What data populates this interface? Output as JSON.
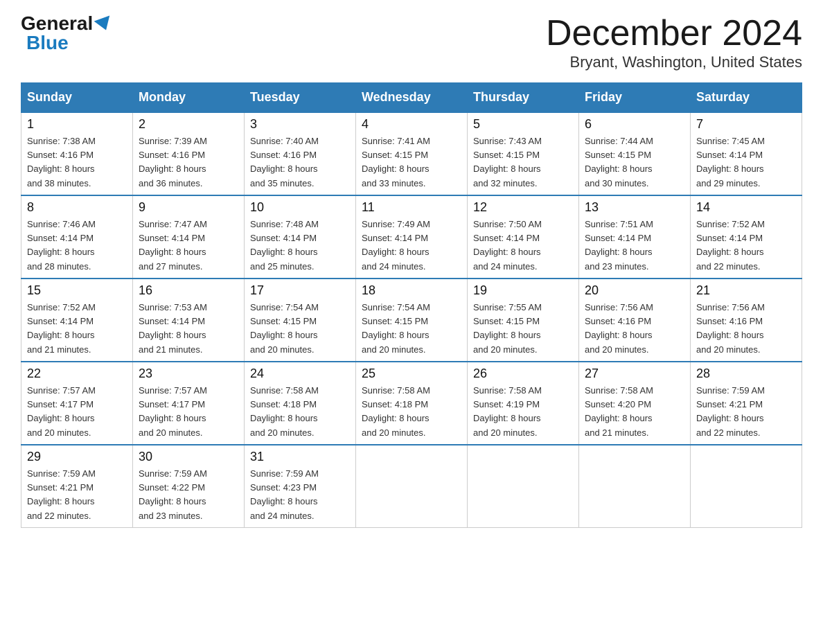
{
  "logo": {
    "general": "General",
    "blue": "Blue"
  },
  "title": "December 2024",
  "location": "Bryant, Washington, United States",
  "days_of_week": [
    "Sunday",
    "Monday",
    "Tuesday",
    "Wednesday",
    "Thursday",
    "Friday",
    "Saturday"
  ],
  "weeks": [
    [
      {
        "day": "1",
        "sunrise": "7:38 AM",
        "sunset": "4:16 PM",
        "daylight": "8 hours and 38 minutes."
      },
      {
        "day": "2",
        "sunrise": "7:39 AM",
        "sunset": "4:16 PM",
        "daylight": "8 hours and 36 minutes."
      },
      {
        "day": "3",
        "sunrise": "7:40 AM",
        "sunset": "4:16 PM",
        "daylight": "8 hours and 35 minutes."
      },
      {
        "day": "4",
        "sunrise": "7:41 AM",
        "sunset": "4:15 PM",
        "daylight": "8 hours and 33 minutes."
      },
      {
        "day": "5",
        "sunrise": "7:43 AM",
        "sunset": "4:15 PM",
        "daylight": "8 hours and 32 minutes."
      },
      {
        "day": "6",
        "sunrise": "7:44 AM",
        "sunset": "4:15 PM",
        "daylight": "8 hours and 30 minutes."
      },
      {
        "day": "7",
        "sunrise": "7:45 AM",
        "sunset": "4:14 PM",
        "daylight": "8 hours and 29 minutes."
      }
    ],
    [
      {
        "day": "8",
        "sunrise": "7:46 AM",
        "sunset": "4:14 PM",
        "daylight": "8 hours and 28 minutes."
      },
      {
        "day": "9",
        "sunrise": "7:47 AM",
        "sunset": "4:14 PM",
        "daylight": "8 hours and 27 minutes."
      },
      {
        "day": "10",
        "sunrise": "7:48 AM",
        "sunset": "4:14 PM",
        "daylight": "8 hours and 25 minutes."
      },
      {
        "day": "11",
        "sunrise": "7:49 AM",
        "sunset": "4:14 PM",
        "daylight": "8 hours and 24 minutes."
      },
      {
        "day": "12",
        "sunrise": "7:50 AM",
        "sunset": "4:14 PM",
        "daylight": "8 hours and 24 minutes."
      },
      {
        "day": "13",
        "sunrise": "7:51 AM",
        "sunset": "4:14 PM",
        "daylight": "8 hours and 23 minutes."
      },
      {
        "day": "14",
        "sunrise": "7:52 AM",
        "sunset": "4:14 PM",
        "daylight": "8 hours and 22 minutes."
      }
    ],
    [
      {
        "day": "15",
        "sunrise": "7:52 AM",
        "sunset": "4:14 PM",
        "daylight": "8 hours and 21 minutes."
      },
      {
        "day": "16",
        "sunrise": "7:53 AM",
        "sunset": "4:14 PM",
        "daylight": "8 hours and 21 minutes."
      },
      {
        "day": "17",
        "sunrise": "7:54 AM",
        "sunset": "4:15 PM",
        "daylight": "8 hours and 20 minutes."
      },
      {
        "day": "18",
        "sunrise": "7:54 AM",
        "sunset": "4:15 PM",
        "daylight": "8 hours and 20 minutes."
      },
      {
        "day": "19",
        "sunrise": "7:55 AM",
        "sunset": "4:15 PM",
        "daylight": "8 hours and 20 minutes."
      },
      {
        "day": "20",
        "sunrise": "7:56 AM",
        "sunset": "4:16 PM",
        "daylight": "8 hours and 20 minutes."
      },
      {
        "day": "21",
        "sunrise": "7:56 AM",
        "sunset": "4:16 PM",
        "daylight": "8 hours and 20 minutes."
      }
    ],
    [
      {
        "day": "22",
        "sunrise": "7:57 AM",
        "sunset": "4:17 PM",
        "daylight": "8 hours and 20 minutes."
      },
      {
        "day": "23",
        "sunrise": "7:57 AM",
        "sunset": "4:17 PM",
        "daylight": "8 hours and 20 minutes."
      },
      {
        "day": "24",
        "sunrise": "7:58 AM",
        "sunset": "4:18 PM",
        "daylight": "8 hours and 20 minutes."
      },
      {
        "day": "25",
        "sunrise": "7:58 AM",
        "sunset": "4:18 PM",
        "daylight": "8 hours and 20 minutes."
      },
      {
        "day": "26",
        "sunrise": "7:58 AM",
        "sunset": "4:19 PM",
        "daylight": "8 hours and 20 minutes."
      },
      {
        "day": "27",
        "sunrise": "7:58 AM",
        "sunset": "4:20 PM",
        "daylight": "8 hours and 21 minutes."
      },
      {
        "day": "28",
        "sunrise": "7:59 AM",
        "sunset": "4:21 PM",
        "daylight": "8 hours and 22 minutes."
      }
    ],
    [
      {
        "day": "29",
        "sunrise": "7:59 AM",
        "sunset": "4:21 PM",
        "daylight": "8 hours and 22 minutes."
      },
      {
        "day": "30",
        "sunrise": "7:59 AM",
        "sunset": "4:22 PM",
        "daylight": "8 hours and 23 minutes."
      },
      {
        "day": "31",
        "sunrise": "7:59 AM",
        "sunset": "4:23 PM",
        "daylight": "8 hours and 24 minutes."
      },
      null,
      null,
      null,
      null
    ]
  ],
  "labels": {
    "sunrise": "Sunrise:",
    "sunset": "Sunset:",
    "daylight": "Daylight:"
  }
}
